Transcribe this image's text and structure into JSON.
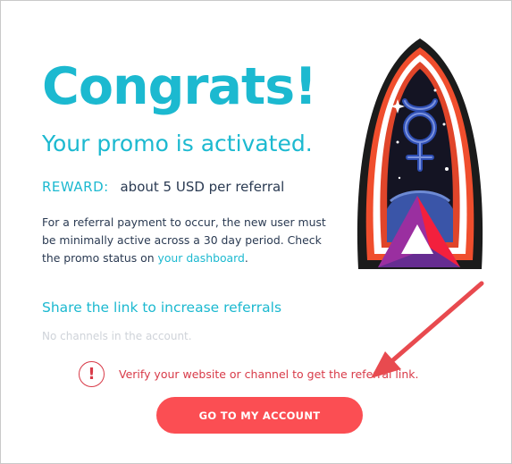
{
  "header": {
    "title": "Congrats!",
    "subtitle": "Your promo is activated."
  },
  "reward": {
    "label": "REWARD:",
    "value": "about 5 USD per referral"
  },
  "description": {
    "text": "For a referral payment to occur, the new user must be minimally active across a 30 day period. Check the promo status on ",
    "link_text": "your dashboard",
    "suffix": "."
  },
  "share": {
    "title": "Share the link to increase referrals",
    "empty_text": "No channels in the account."
  },
  "warning": {
    "icon": "!",
    "text": "Verify your website or channel to get the referral link."
  },
  "cta": {
    "label": "GO TO MY ACCOUNT"
  },
  "colors": {
    "accent": "#1cb9d0",
    "error": "#d83a48",
    "button": "#fb4e53",
    "body_text": "#2a3a52"
  }
}
